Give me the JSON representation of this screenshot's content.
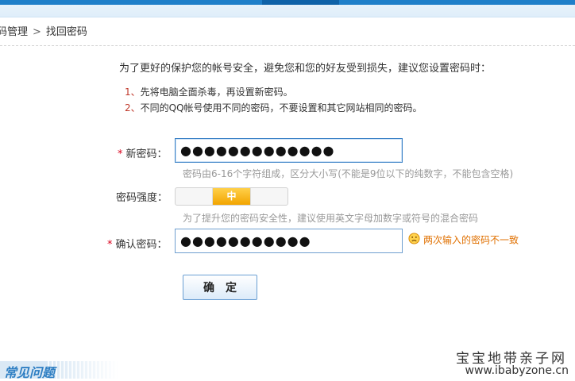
{
  "breadcrumb": {
    "prev": "码管理",
    "separator": ">",
    "current": "找回密码"
  },
  "advice": {
    "title": "为了更好的保护您的帐号安全，避免您和您的好友受到损失，建议您设置密码时：",
    "tips": [
      {
        "num": "1、",
        "text": "先将电脑全面杀毒，再设置新密码。"
      },
      {
        "num": "2、",
        "text": "不同的QQ帐号使用不同的密码，不要设置和其它网站相同的密码。"
      }
    ]
  },
  "form": {
    "new_password": {
      "required_mark": "*",
      "label": "新密码：",
      "value": "●●●●●●●●●●●●●",
      "hint": "密码由6-16个字符组成，区分大小写(不能是9位以下的纯数字，不能包含空格)"
    },
    "strength": {
      "label": "密码强度：",
      "segments": [
        "",
        "中",
        "",
        ""
      ],
      "level": "中",
      "active_index": 1,
      "hint": "为了提升您的密码安全性，建议使用英文字母加数字或符号的混合密码"
    },
    "confirm_password": {
      "required_mark": "*",
      "label": "确认密码：",
      "value": "●●●●●●●●●●●",
      "error": "两次输入的密码不一致",
      "error_icon": "sad-face-icon"
    },
    "submit_label": "确定"
  },
  "footer": {
    "faq": "常见问题",
    "watermark_cn": "宝宝地带亲子网",
    "watermark_url": "www.ibabyzone.cn"
  },
  "colors": {
    "accent": "#1f7fc9",
    "error": "#e07000",
    "required": "#d9001b",
    "meter_active": "#f2a500"
  }
}
